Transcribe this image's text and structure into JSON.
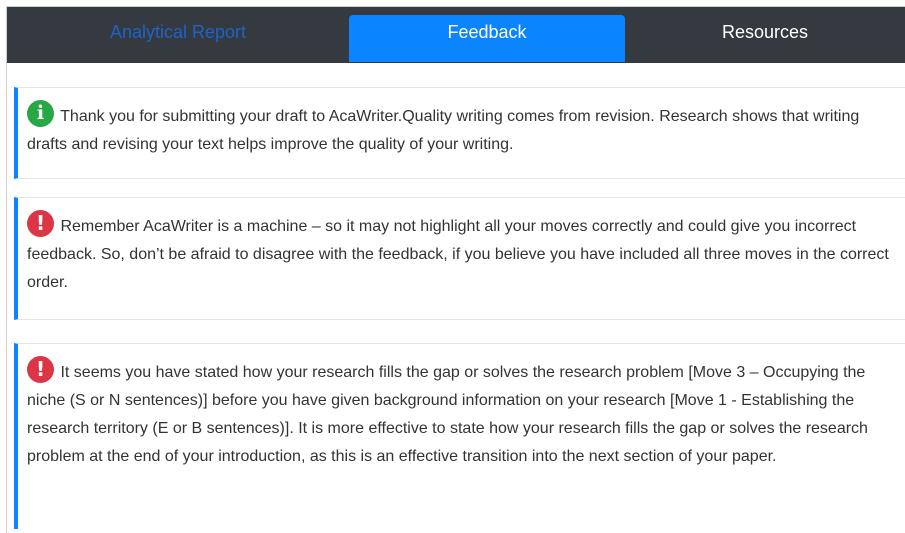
{
  "tabs": [
    {
      "label": "Analytical Report",
      "active": false
    },
    {
      "label": "Feedback",
      "active": true
    },
    {
      "label": "Resources",
      "active": false
    }
  ],
  "colors": {
    "tabbar_bg": "#343a40",
    "active_tab": "#0a84ff",
    "info_icon": "#28a745",
    "alert_icon": "#dc3545",
    "card_accent": "#0a84ff"
  },
  "messages": [
    {
      "icon": "info-icon",
      "text": "Thank you for submitting your draft to AcaWriter.Quality writing comes from revision. Research shows that writing drafts and revising your text helps improve the quality of your writing."
    },
    {
      "icon": "alert-icon",
      "text": "Remember AcaWriter is a machine – so it may not highlight all your moves correctly and could give you incorrect feedback. So, don’t be afraid to disagree with the feedback, if you believe you have included all three moves in the correct order."
    },
    {
      "icon": "alert-icon",
      "text": "It seems you have stated how your research fills the gap or solves the research problem [Move 3 – Occupying the niche (S or N sentences)] before you have given background information on your research [Move 1 - Establishing the research territory (E or B sentences)]. It is more effective to state how your research fills the gap or solves the research problem at the end of your introduction, as this is an effective transition into the next section of your paper."
    }
  ]
}
